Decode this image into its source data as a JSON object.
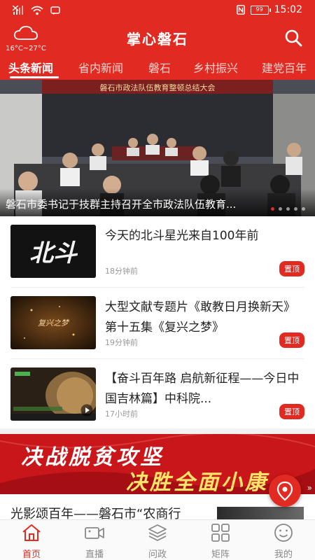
{
  "status_bar": {
    "battery": "99",
    "time": "15:02"
  },
  "header": {
    "weather_temp": "16°C~27°C",
    "title": "掌心磐石"
  },
  "tabs": [
    {
      "label": "头条新闻",
      "active": true
    },
    {
      "label": "省内新闻"
    },
    {
      "label": "磐石"
    },
    {
      "label": "乡村振兴"
    },
    {
      "label": "建党百年"
    }
  ],
  "banner": {
    "caption": "磐石市委书记于技群主持召开全市政法队伍教育...",
    "background_text": "磐石市政法队伍教育整顿总结大会"
  },
  "news": [
    {
      "title": "今天的北斗星光来自100年前",
      "time": "18分钟前",
      "badge": "置顶",
      "thumb_text": "北斗"
    },
    {
      "title": "大型文献专题片《敢教日月换新天》第十五集《复兴之梦》",
      "time": "19分钟前",
      "badge": "置顶",
      "thumb_text": "复兴之梦"
    },
    {
      "title": "【奋斗百年路 启航新征程——今日中国吉林篇】中科院...",
      "time": "17小时前",
      "badge": "置顶"
    }
  ],
  "promo": {
    "line1": "决战脱贫攻坚",
    "line2": "决胜全面小康"
  },
  "next_item": {
    "title": "光影颂百年——磐石市“农商行"
  },
  "bottom_nav": [
    {
      "label": "首页",
      "icon": "home-icon",
      "active": true
    },
    {
      "label": "直播",
      "icon": "video-camera-icon"
    },
    {
      "label": "问政",
      "icon": "stack-icon"
    },
    {
      "label": "矩阵",
      "icon": "grid-icon"
    },
    {
      "label": "我的",
      "icon": "smiley-icon"
    }
  ],
  "colors": {
    "brand": "#e12b22",
    "inactive": "#888888"
  }
}
